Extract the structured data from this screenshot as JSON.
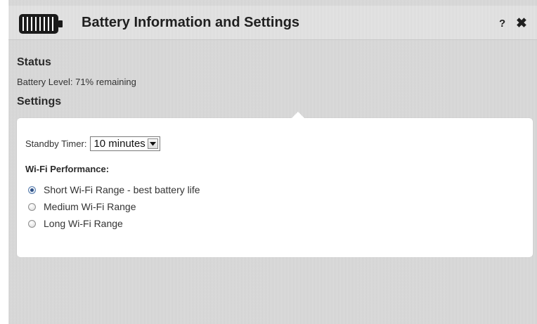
{
  "header": {
    "title": "Battery Information and Settings",
    "help_label": "?",
    "close_label": "✖",
    "battery_icon": "battery-full-icon"
  },
  "status": {
    "title": "Status",
    "battery_level": "Battery Level: 71% remaining"
  },
  "settings": {
    "title": "Settings",
    "standby_label": "Standby Timer:",
    "standby_value": "10 minutes",
    "wifi_title": "Wi-Fi Performance:",
    "wifi_options": [
      {
        "label": "Short Wi-Fi Range - best battery life",
        "selected": true
      },
      {
        "label": "Medium Wi-Fi Range",
        "selected": false
      },
      {
        "label": "Long Wi-Fi Range",
        "selected": false
      }
    ]
  },
  "colors": {
    "dialog_bg": "#d6d6d6",
    "panel_bg": "#ffffff",
    "text": "#333333"
  }
}
